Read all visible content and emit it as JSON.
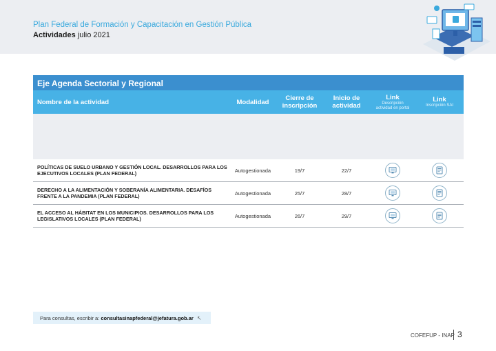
{
  "header": {
    "title": "Plan Federal de Formación y Capacitación en Gestión Pública",
    "subtitle_bold": "Actividades",
    "subtitle_rest": " julio 2021"
  },
  "table": {
    "section_title": "Eje Agenda Sectorial y Regional",
    "columns": {
      "name": "Nombre de la actividad",
      "modalidad": "Modalidad",
      "cierre_1": "Cierre de",
      "cierre_2": "inscripción",
      "inicio_1": "Inicio de",
      "inicio_2": "actividad",
      "link1": "Link",
      "link1_sub_1": "Descripción",
      "link1_sub_2": "actividad en portal",
      "link2": "Link",
      "link2_sub": "Inscripción SAI"
    },
    "rows": [
      {
        "name": "Políticas de suelo urbano y gestión local. Desarrollos para los ejecutivos locales (Plan Federal)",
        "modalidad": "Autogestionada",
        "cierre": "19/7",
        "inicio": "22/7"
      },
      {
        "name": "Derecho a la alimentación y soberanía alimentaria. Desafíos frente a la pandemia (Plan Federal)",
        "modalidad": "Autogestionada",
        "cierre": "25/7",
        "inicio": "28/7"
      },
      {
        "name": "El acceso al hábitat en los municipios. Desarrollos para los legislativos locales (Plan Federal)",
        "modalidad": "Autogestionada",
        "cierre": "26/7",
        "inicio": "29/7"
      }
    ],
    "icons": {
      "link1": "monitor-icon",
      "link2": "form-icon"
    }
  },
  "footer": {
    "consult_label": "Para consultas, escribir a: ",
    "email": "consultasinapfederal@jefatura.gob.ar",
    "org": "COFEFUP - INAP",
    "page": "3"
  },
  "colors": {
    "dark_band": "#3b8fcf",
    "light_band": "#47b2e6",
    "title": "#3aa9dd"
  }
}
